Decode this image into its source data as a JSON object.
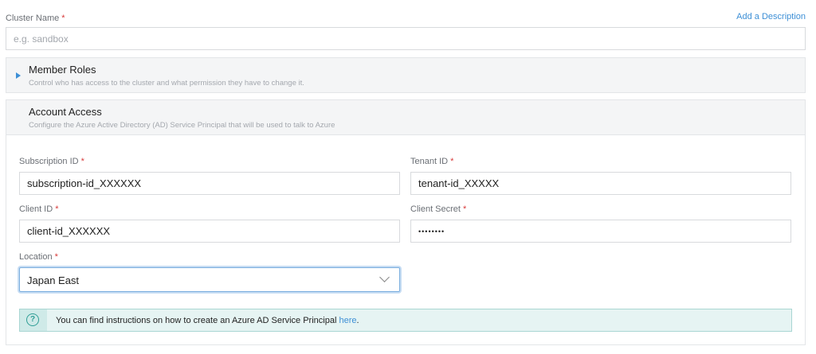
{
  "cluster": {
    "name_label": "Cluster Name",
    "required_mark": "*",
    "add_description": "Add a Description",
    "name_placeholder": "e.g. sandbox",
    "name_value": ""
  },
  "member_roles": {
    "title": "Member Roles",
    "subtitle": "Control who has access to the cluster and what permission they have to change it.",
    "expanded": false
  },
  "account_access": {
    "title": "Account Access",
    "subtitle": "Configure the Azure Active Directory (AD) Service Principal that will be used to talk to Azure",
    "subscription_label": "Subscription ID",
    "subscription_value": "subscription-id_XXXXXX",
    "tenant_label": "Tenant ID",
    "tenant_value": "tenant-id_XXXXX",
    "client_label": "Client ID",
    "client_value": "client-id_XXXXXX",
    "secret_label": "Client Secret",
    "secret_value": "secretxx",
    "location_label": "Location",
    "location_value": "Japan East"
  },
  "info": {
    "text": "You can find instructions on how to create an Azure AD Service Principal ",
    "link": "here",
    "suffix": "."
  },
  "icons": {
    "expand": "triangle-right-icon",
    "select": "chevron-down-icon",
    "info": "question-circle-icon"
  },
  "colors": {
    "accent": "#3d8fd6",
    "required": "#d83a3a",
    "info_border": "#a9d6d3",
    "info_bg": "#e6f4f3"
  }
}
